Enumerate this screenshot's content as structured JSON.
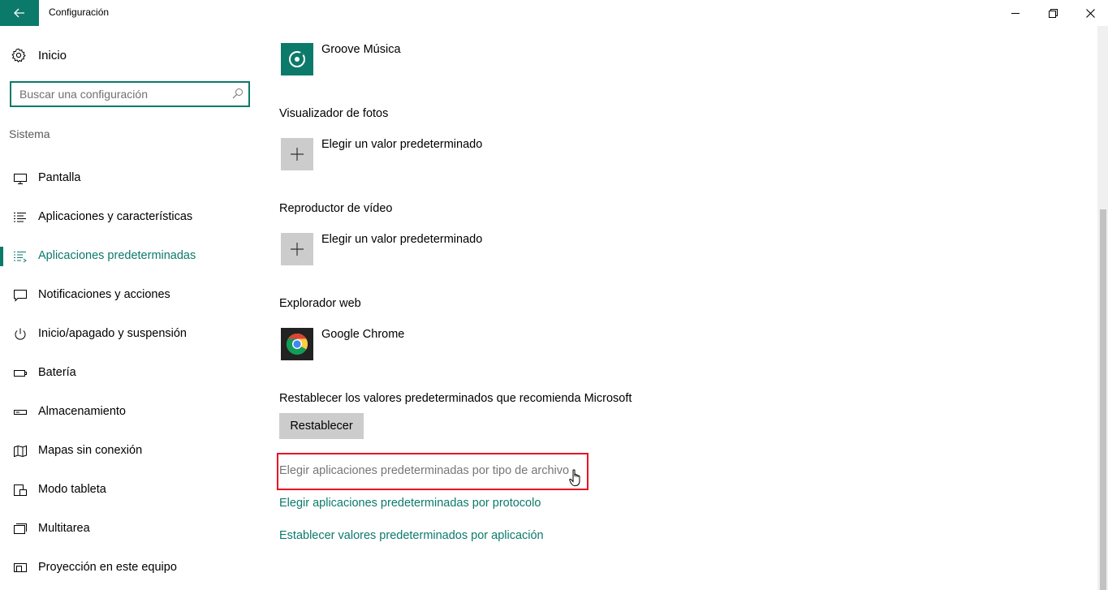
{
  "window": {
    "title": "Configuración",
    "accent_color": "#0b7a6a"
  },
  "sidebar": {
    "home_label": "Inicio",
    "search_placeholder": "Buscar una configuración",
    "section_label": "Sistema",
    "items": [
      {
        "label": "Pantalla",
        "icon": "monitor-icon"
      },
      {
        "label": "Aplicaciones y características",
        "icon": "list-icon"
      },
      {
        "label": "Aplicaciones predeterminadas",
        "icon": "default-apps-icon",
        "active": true
      },
      {
        "label": "Notificaciones y acciones",
        "icon": "notification-icon"
      },
      {
        "label": "Inicio/apagado y suspensión",
        "icon": "power-icon"
      },
      {
        "label": "Batería",
        "icon": "battery-icon"
      },
      {
        "label": "Almacenamiento",
        "icon": "storage-icon"
      },
      {
        "label": "Mapas sin conexión",
        "icon": "map-icon"
      },
      {
        "label": "Modo tableta",
        "icon": "tablet-icon"
      },
      {
        "label": "Multitarea",
        "icon": "multitask-icon"
      },
      {
        "label": "Proyección en este equipo",
        "icon": "projection-icon"
      }
    ]
  },
  "main": {
    "music_app": "Groove Música",
    "photo_title": "Visualizador de fotos",
    "photo_app": "Elegir un valor predeterminado",
    "video_title": "Reproductor de vídeo",
    "video_app": "Elegir un valor predeterminado",
    "web_title": "Explorador web",
    "web_app": "Google Chrome",
    "reset_title": "Restablecer los valores predeterminados que recomienda Microsoft",
    "reset_button": "Restablecer",
    "links": [
      "Elegir aplicaciones predeterminadas por tipo de archivo",
      "Elegir aplicaciones predeterminadas por protocolo",
      "Establecer valores predeterminados por aplicación"
    ]
  }
}
